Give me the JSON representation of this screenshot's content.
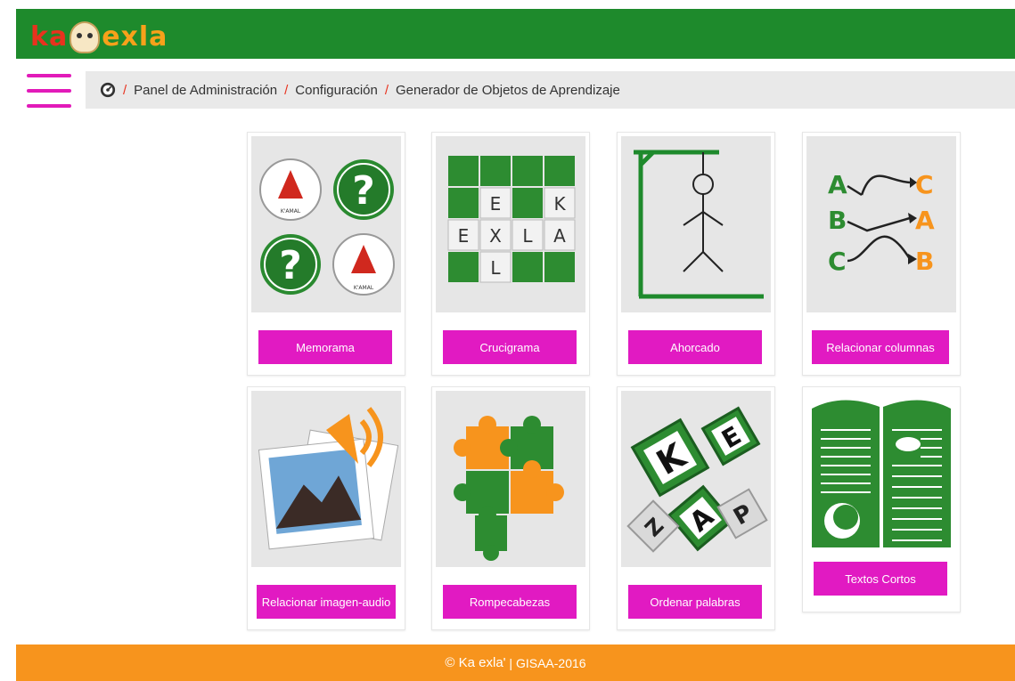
{
  "header": {
    "logo": {
      "part1": "ka",
      "part2": "exla",
      "icon": "face-logo-icon"
    },
    "brand_color": "#1e8a2c"
  },
  "menu": {
    "icon": "hamburger-menu-icon"
  },
  "breadcrumb": {
    "home_icon": "dashboard-gauge-icon",
    "separator": "/",
    "items": [
      "Panel de Administración",
      "Configuración",
      "Generador de Objetos de Aprendizaje"
    ]
  },
  "cards": [
    {
      "label": "Memorama",
      "icon": "memory-cards-icon"
    },
    {
      "label": "Crucigrama",
      "icon": "crossword-icon",
      "letters": {
        "row2": [
          "E",
          "K"
        ],
        "row3": [
          "E",
          "X",
          "L",
          "A"
        ],
        "row4": [
          "L"
        ]
      }
    },
    {
      "label": "Ahorcado",
      "icon": "hangman-icon"
    },
    {
      "label": "Relacionar columnas",
      "icon": "match-columns-icon",
      "left": [
        "A",
        "B",
        "C"
      ],
      "right": [
        "C",
        "A",
        "B"
      ]
    },
    {
      "label": "Relacionar imagen-audio",
      "icon": "image-audio-icon"
    },
    {
      "label": "Rompecabezas",
      "icon": "puzzle-icon"
    },
    {
      "label": "Ordenar palabras",
      "icon": "letter-tiles-icon",
      "letters": [
        "K",
        "E",
        "A",
        "Z",
        "P"
      ]
    },
    {
      "label": "Textos Cortos",
      "icon": "open-book-icon"
    }
  ],
  "memorama": {
    "caption": "K'AMAL",
    "question": "?"
  },
  "footer": {
    "brand": "© Ka exla'",
    "rest": " | GISAA-2016"
  },
  "colors": {
    "accent": "#e11ac2",
    "footer": "#f7941d",
    "green": "#1e8a2c"
  }
}
